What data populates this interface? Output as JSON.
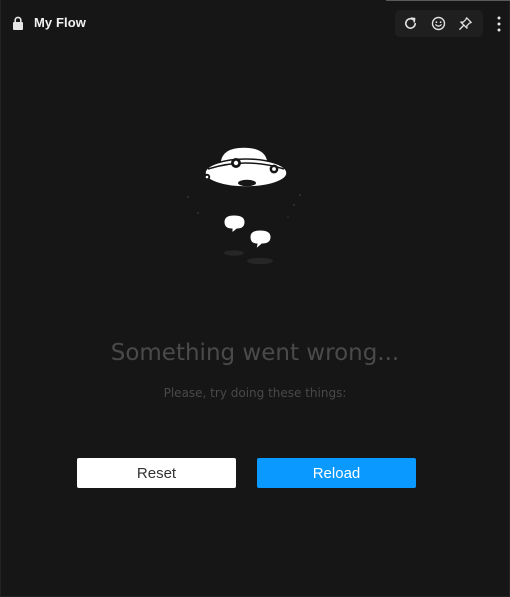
{
  "header": {
    "title": "My Flow",
    "icons": {
      "lock": "lock-icon",
      "refresh": "refresh-icon",
      "smiley": "smiley-icon",
      "pin": "pin-icon",
      "more": "more-vertical-icon"
    }
  },
  "error": {
    "illustration": "ufo-illustration",
    "heading": "Something went wrong...",
    "subtext": "Please, try doing these things:"
  },
  "actions": {
    "reset_label": "Reset",
    "reload_label": "Reload"
  },
  "colors": {
    "background": "#161616",
    "accent": "#0a99ff",
    "secondary_button": "#ffffff",
    "heading_text": "#4a4a4a"
  }
}
